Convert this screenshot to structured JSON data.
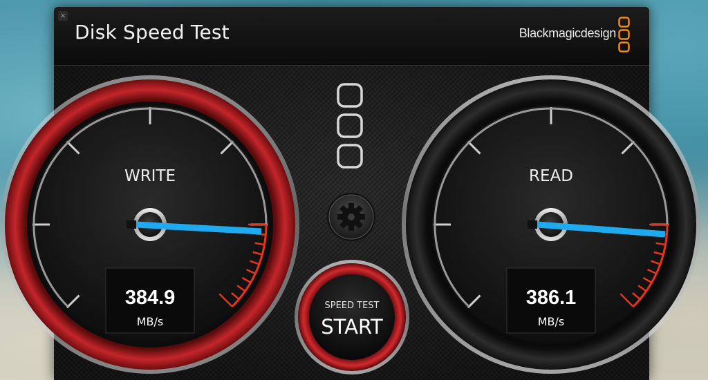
{
  "app": {
    "title": "Disk Speed Test",
    "close_glyph": "×",
    "brand": "Blackmagicdesign",
    "brand_logo_icon": "blackmagic-three-rings-icon"
  },
  "write_gauge": {
    "label": "WRITE",
    "value": "384.9",
    "unit": "MB/s",
    "needle_fraction": 0.965,
    "ring_color": "#b3191d",
    "active": true
  },
  "read_gauge": {
    "label": "READ",
    "value": "386.1",
    "unit": "MB/s",
    "needle_fraction": 0.97,
    "ring_color": "#2a2a2a",
    "active": false
  },
  "center": {
    "format_icon": "three-stacked-rings-icon",
    "settings_icon": "gear-icon",
    "start_button": {
      "line1": "SPEED TEST",
      "line2": "START"
    }
  },
  "colors": {
    "needle": "#1fa9ee",
    "redline": "#e8341c",
    "brand_orange": "#f08a1e"
  }
}
